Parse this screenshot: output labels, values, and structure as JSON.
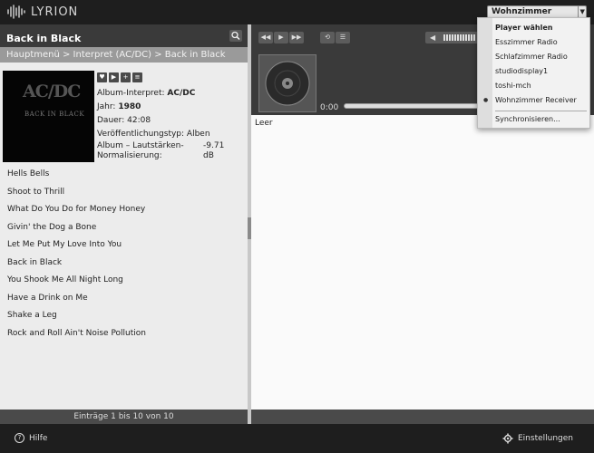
{
  "app": {
    "title": "LYRION"
  },
  "player_button": {
    "label": "Wohnzimmer Receiver"
  },
  "left": {
    "title": "Back in Black",
    "breadcrumb": "Hauptmenü > Interpret (AC/DC) > Back in Black",
    "cover": {
      "band": "AC/DC",
      "album": "BACK IN BLACK"
    },
    "meta": {
      "artist_label": "Album-Interpret:",
      "artist_value": "AC/DC",
      "year_label": "Jahr:",
      "year_value": "1980",
      "duration_label": "Dauer:",
      "duration_value": "42:08",
      "type_label": "Veröffentlichungstyp:",
      "type_value": "Alben",
      "norm_label": "Album – Lautstärken-Normalisierung:",
      "norm_value": "-9.71 dB"
    },
    "tracks": [
      "Hells Bells",
      "Shoot to Thrill",
      "What Do You Do for Money Honey",
      "Givin' the Dog a Bone",
      "Let Me Put My Love Into You",
      "Back in Black",
      "You Shook Me All Night Long",
      "Have a Drink on Me",
      "Shake a Leg",
      "Rock and Roll Ain't Noise Pollution"
    ],
    "footer": "Einträge 1 bis 10 von 10"
  },
  "right": {
    "time": "0:00",
    "playlist_empty": "Leer"
  },
  "dropdown": {
    "header": "Player wählen",
    "items": [
      "Esszimmer Radio",
      "Schlafzimmer Radio",
      "studiodisplay1",
      "toshi-mch",
      "Wohnzimmer Receiver"
    ],
    "selected": "Wohnzimmer Receiver",
    "sync": "Synchronisieren..."
  },
  "bottom": {
    "help": "Hilfe",
    "settings": "Einstellungen"
  },
  "colors": {
    "topbar": "#1e1e1e",
    "panel_header": "#3a3a3a",
    "breadcrumb": "#9a9a9a"
  }
}
